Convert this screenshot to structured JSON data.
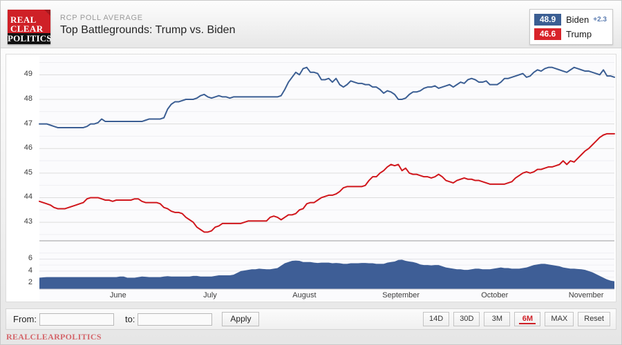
{
  "header": {
    "kicker": "RCP POLL AVERAGE",
    "title": "Top Battlegrounds: Trump vs. Biden",
    "logo_line1": "REAL",
    "logo_line2": "CLEAR",
    "logo_line3": "POLITICS"
  },
  "legend": {
    "rows": [
      {
        "value": "48.9",
        "name": "Biden",
        "delta": "+2.3",
        "color": "#3b5e93"
      },
      {
        "value": "46.6",
        "name": "Trump",
        "delta": "",
        "color": "#d8232a"
      }
    ]
  },
  "controls": {
    "from_label": "From:",
    "from_value": "",
    "from_placeholder": "",
    "to_label": "to:",
    "to_value": "",
    "to_placeholder": "",
    "apply_label": "Apply",
    "ranges": [
      {
        "label": "14D",
        "active": false
      },
      {
        "label": "30D",
        "active": false
      },
      {
        "label": "3M",
        "active": false
      },
      {
        "label": "6M",
        "active": true
      },
      {
        "label": "MAX",
        "active": false
      },
      {
        "label": "Reset",
        "active": false
      }
    ]
  },
  "watermark": "REALCLEARPOLITICS",
  "chart_data": {
    "type": "line",
    "title": "Top Battlegrounds: Trump vs. Biden",
    "subtitle": "RCP POLL AVERAGE",
    "xlabel": "",
    "ylabel": "",
    "grid": true,
    "legend_position": "top-right",
    "colors": {
      "biden": "#3b5e93",
      "trump": "#d0161c",
      "spread_fill": "#3e5e96"
    },
    "x_tick_labels": [
      "June",
      "July",
      "August",
      "September",
      "October",
      "November"
    ],
    "x_tick_positions": [
      0.138,
      0.298,
      0.462,
      0.63,
      0.793,
      0.952
    ],
    "y_tick_labels": [
      "43",
      "44",
      "45",
      "46",
      "47",
      "48",
      "49"
    ],
    "ylim": [
      42.3,
      49.6
    ],
    "spread_y_tick_labels": [
      "2",
      "4",
      "6"
    ],
    "spread_ylim": [
      1.0,
      7.2
    ],
    "series": [
      {
        "name": "Biden",
        "color": "#3b5e93",
        "values": [
          47.0,
          47.0,
          47.0,
          46.95,
          46.9,
          46.85,
          46.85,
          46.85,
          46.85,
          46.85,
          46.85,
          46.85,
          46.85,
          46.9,
          47.0,
          47.0,
          47.05,
          47.2,
          47.1,
          47.1,
          47.1,
          47.1,
          47.1,
          47.1,
          47.1,
          47.1,
          47.1,
          47.1,
          47.1,
          47.15,
          47.2,
          47.2,
          47.2,
          47.2,
          47.25,
          47.6,
          47.8,
          47.9,
          47.9,
          47.95,
          48.0,
          48.0,
          48.0,
          48.05,
          48.15,
          48.2,
          48.1,
          48.05,
          48.1,
          48.15,
          48.1,
          48.1,
          48.05,
          48.1,
          48.1,
          48.1,
          48.1,
          48.1,
          48.1,
          48.1,
          48.1,
          48.1,
          48.1,
          48.1,
          48.1,
          48.1,
          48.15,
          48.4,
          48.7,
          48.9,
          49.1,
          49.0,
          49.25,
          49.3,
          49.1,
          49.1,
          49.05,
          48.8,
          48.8,
          48.85,
          48.7,
          48.85,
          48.6,
          48.5,
          48.6,
          48.75,
          48.7,
          48.65,
          48.65,
          48.6,
          48.6,
          48.5,
          48.5,
          48.4,
          48.25,
          48.35,
          48.3,
          48.2,
          48.0,
          48.0,
          48.05,
          48.2,
          48.3,
          48.3,
          48.35,
          48.45,
          48.5,
          48.5,
          48.55,
          48.45,
          48.5,
          48.55,
          48.6,
          48.5,
          48.6,
          48.7,
          48.65,
          48.8,
          48.85,
          48.8,
          48.7,
          48.7,
          48.75,
          48.6,
          48.6,
          48.6,
          48.7,
          48.85,
          48.85,
          48.9,
          48.95,
          49.0,
          49.05,
          48.9,
          48.95,
          49.1,
          49.2,
          49.15,
          49.25,
          49.3,
          49.3,
          49.25,
          49.2,
          49.15,
          49.1,
          49.2,
          49.3,
          49.25,
          49.2,
          49.15,
          49.15,
          49.1,
          49.05,
          49.0,
          49.2,
          48.95,
          48.95,
          48.9
        ]
      },
      {
        "name": "Trump",
        "color": "#d0161c",
        "values": [
          43.85,
          43.8,
          43.75,
          43.7,
          43.6,
          43.55,
          43.55,
          43.55,
          43.6,
          43.65,
          43.7,
          43.75,
          43.8,
          43.95,
          44.0,
          44.0,
          44.0,
          43.95,
          43.9,
          43.9,
          43.85,
          43.9,
          43.9,
          43.9,
          43.9,
          43.9,
          43.95,
          43.95,
          43.85,
          43.8,
          43.8,
          43.8,
          43.8,
          43.75,
          43.6,
          43.55,
          43.45,
          43.4,
          43.4,
          43.35,
          43.2,
          43.1,
          43.0,
          42.8,
          42.7,
          42.6,
          42.6,
          42.65,
          42.8,
          42.85,
          42.95,
          42.95,
          42.95,
          42.95,
          42.95,
          42.95,
          43.0,
          43.05,
          43.05,
          43.05,
          43.05,
          43.05,
          43.05,
          43.2,
          43.25,
          43.2,
          43.1,
          43.2,
          43.3,
          43.3,
          43.35,
          43.5,
          43.55,
          43.75,
          43.8,
          43.8,
          43.9,
          44.0,
          44.05,
          44.1,
          44.1,
          44.15,
          44.25,
          44.4,
          44.45,
          44.45,
          44.45,
          44.45,
          44.45,
          44.5,
          44.7,
          44.85,
          44.85,
          45.0,
          45.1,
          45.25,
          45.35,
          45.3,
          45.35,
          45.1,
          45.2,
          45.0,
          44.95,
          44.95,
          44.9,
          44.85,
          44.85,
          44.8,
          44.85,
          44.95,
          44.85,
          44.7,
          44.65,
          44.6,
          44.7,
          44.75,
          44.8,
          44.75,
          44.75,
          44.7,
          44.7,
          44.65,
          44.6,
          44.55,
          44.55,
          44.55,
          44.55,
          44.55,
          44.6,
          44.65,
          44.8,
          44.9,
          45.0,
          45.05,
          45.0,
          45.05,
          45.15,
          45.15,
          45.2,
          45.25,
          45.25,
          45.3,
          45.35,
          45.5,
          45.35,
          45.5,
          45.45,
          45.6,
          45.75,
          45.9,
          46.0,
          46.15,
          46.3,
          46.45,
          46.55,
          46.6,
          46.6,
          46.6
        ]
      }
    ],
    "spread_series": {
      "name": "Spread",
      "color": "#3e5e96",
      "values": [
        2.9,
        2.95,
        3.0,
        3.0,
        3.0,
        3.0,
        3.0,
        3.0,
        3.0,
        3.0,
        3.0,
        3.0,
        3.0,
        3.0,
        3.0,
        3.0,
        3.0,
        3.0,
        3.0,
        3.0,
        3.0,
        3.0,
        3.1,
        3.1,
        2.9,
        2.9,
        2.9,
        3.0,
        3.1,
        3.05,
        3.0,
        3.0,
        3.0,
        3.0,
        3.1,
        3.15,
        3.1,
        3.1,
        3.1,
        3.1,
        3.1,
        3.1,
        3.2,
        3.2,
        3.1,
        3.1,
        3.1,
        3.1,
        3.2,
        3.3,
        3.3,
        3.3,
        3.3,
        3.4,
        3.7,
        4.0,
        4.1,
        4.2,
        4.3,
        4.3,
        4.4,
        4.35,
        4.3,
        4.3,
        4.4,
        4.5,
        4.9,
        5.3,
        5.5,
        5.7,
        5.75,
        5.7,
        5.5,
        5.5,
        5.5,
        5.4,
        5.35,
        5.4,
        5.4,
        5.4,
        5.3,
        5.35,
        5.3,
        5.2,
        5.2,
        5.3,
        5.3,
        5.3,
        5.35,
        5.35,
        5.3,
        5.3,
        5.2,
        5.2,
        5.2,
        5.4,
        5.5,
        5.6,
        5.85,
        5.9,
        5.7,
        5.6,
        5.5,
        5.35,
        5.1,
        5.0,
        5.0,
        4.95,
        5.0,
        5.0,
        4.8,
        4.6,
        4.5,
        4.4,
        4.3,
        4.3,
        4.2,
        4.2,
        4.3,
        4.4,
        4.4,
        4.3,
        4.3,
        4.3,
        4.4,
        4.5,
        4.6,
        4.5,
        4.5,
        4.4,
        4.4,
        4.4,
        4.5,
        4.6,
        4.8,
        5.0,
        5.1,
        5.2,
        5.2,
        5.1,
        5.0,
        4.9,
        4.8,
        4.6,
        4.5,
        4.4,
        4.4,
        4.35,
        4.3,
        4.2,
        4.0,
        3.8,
        3.5,
        3.2,
        2.9,
        2.6,
        2.4,
        2.3
      ]
    }
  }
}
